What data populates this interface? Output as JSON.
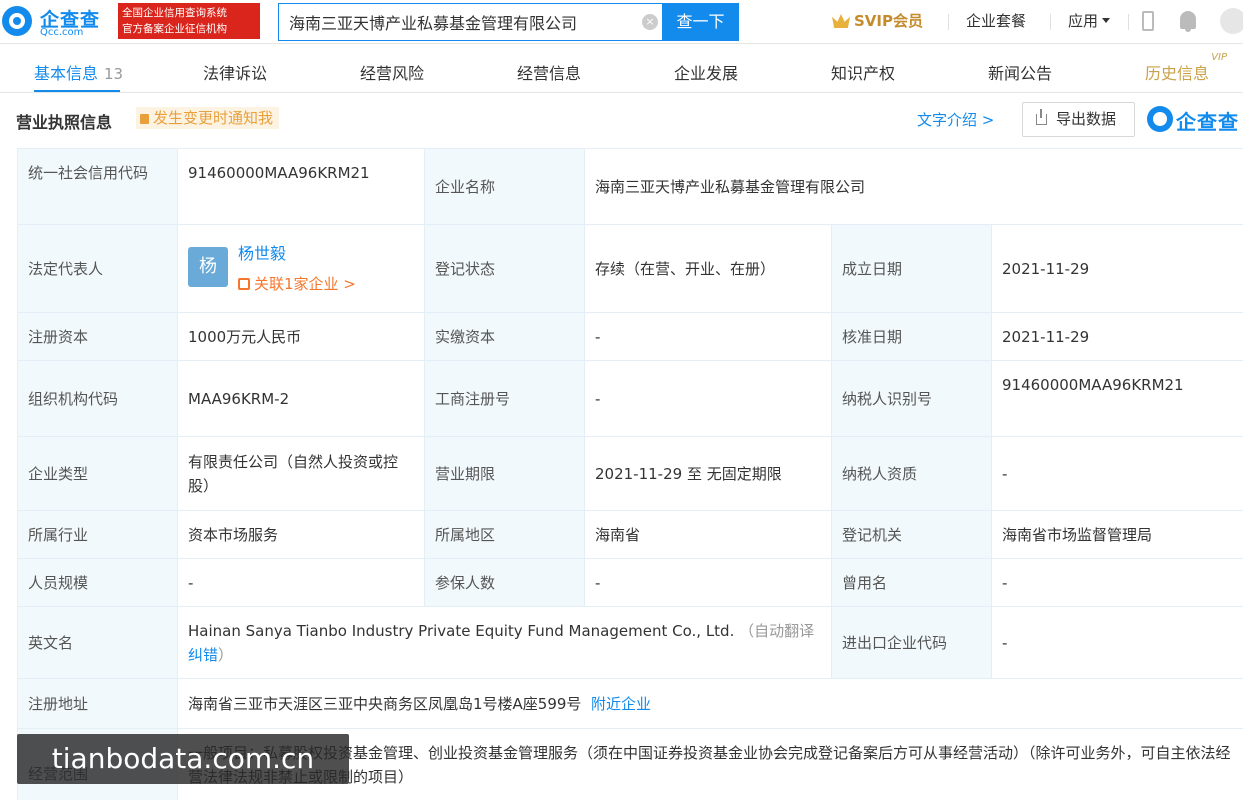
{
  "header": {
    "logo_name": "企查查",
    "logo_domain": "Qcc.com",
    "badge_line1": "全国企业信用查询系统",
    "badge_line2": "官方备案企业征信机构",
    "search_value": "海南三亚天博产业私募基金管理有限公司",
    "search_button": "查一下",
    "svip": "SVIP会员",
    "package": "企业套餐",
    "apps": "应用"
  },
  "tabs": [
    {
      "label": "基本信息",
      "count": "13"
    },
    {
      "label": "法律诉讼"
    },
    {
      "label": "经营风险"
    },
    {
      "label": "经营信息"
    },
    {
      "label": "企业发展"
    },
    {
      "label": "知识产权"
    },
    {
      "label": "新闻公告"
    },
    {
      "label": "历史信息",
      "sup": "VIP"
    }
  ],
  "section": {
    "title": "营业执照信息",
    "notify": "发生变更时通知我",
    "text_intro": "文字介绍 >",
    "export": "导出数据",
    "brand": "企查查"
  },
  "info": {
    "credit_code_label": "统一社会信用代码",
    "credit_code": "91460000MAA96KRM21",
    "company_name_label": "企业名称",
    "company_name": "海南三亚天博产业私募基金管理有限公司",
    "legal_rep_label": "法定代表人",
    "legal_rep_avatar": "杨",
    "legal_rep_name": "杨世毅",
    "legal_rep_related": "关联1家企业 >",
    "reg_status_label": "登记状态",
    "reg_status": "存续（在营、开业、在册）",
    "found_date_label": "成立日期",
    "found_date": "2021-11-29",
    "reg_capital_label": "注册资本",
    "reg_capital": "1000万元人民币",
    "paid_capital_label": "实缴资本",
    "paid_capital": "-",
    "approval_date_label": "核准日期",
    "approval_date": "2021-11-29",
    "org_code_label": "组织机构代码",
    "org_code": "MAA96KRM-2",
    "biz_reg_no_label": "工商注册号",
    "biz_reg_no": "-",
    "taxpayer_id_label": "纳税人识别号",
    "taxpayer_id": "91460000MAA96KRM21",
    "company_type_label": "企业类型",
    "company_type": "有限责任公司（自然人投资或控股）",
    "biz_term_label": "营业期限",
    "biz_term": "2021-11-29 至 无固定期限",
    "taxpayer_qual_label": "纳税人资质",
    "taxpayer_qual": "-",
    "industry_label": "所属行业",
    "industry": "资本市场服务",
    "region_label": "所属地区",
    "region": "海南省",
    "authority_label": "登记机关",
    "authority": "海南省市场监督管理局",
    "staff_size_label": "人员规模",
    "staff_size": "-",
    "insured_label": "参保人数",
    "insured": "-",
    "former_name_label": "曾用名",
    "former_name": "-",
    "english_name_label": "英文名",
    "english_name": "Hainan Sanya Tianbo Industry Private Equity Fund Management Co., Ltd.",
    "auto_translate": "（自动翻译",
    "correct": "纠错",
    "close_paren": "）",
    "import_export_label": "进出口企业代码",
    "import_export": "-",
    "address_label": "注册地址",
    "address": "海南省三亚市天涯区三亚中央商务区凤凰岛1号楼A座599号",
    "nearby": "附近企业",
    "scope_label": "经营范围",
    "scope": "一般项目：私募股权投资基金管理、创业投资基金管理服务（须在中国证券投资基金业协会完成登记备案后方可从事经营活动）（除许可业务外，可自主依法经营法律法规非禁止或限制的项目）"
  },
  "watermark": "tianbodata.com.cn"
}
